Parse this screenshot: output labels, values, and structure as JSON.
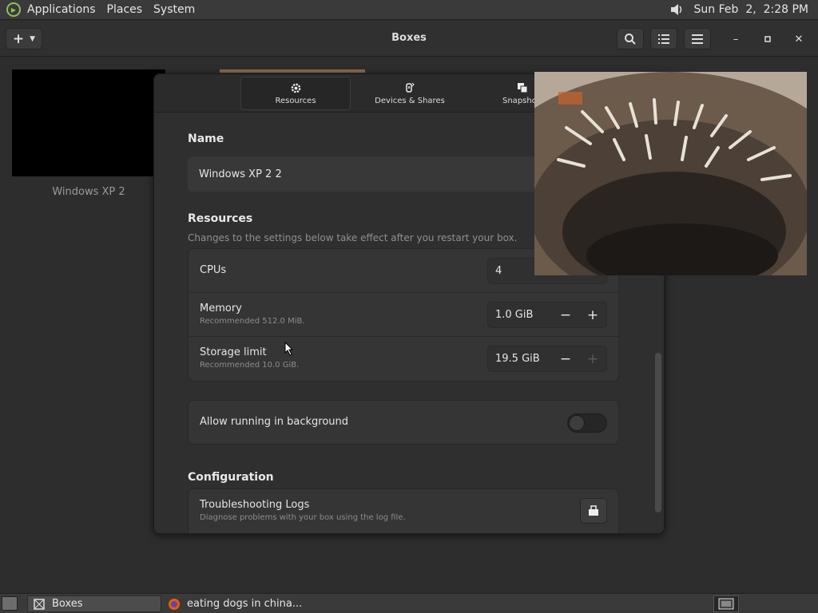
{
  "top_panel": {
    "menu": [
      "Applications",
      "Places",
      "System"
    ],
    "clock": "Sun Feb  2,  2:28 PM"
  },
  "headerbar": {
    "title": "Boxes"
  },
  "collection": {
    "vm_label": "Windows XP 2"
  },
  "dialog": {
    "tabs": [
      {
        "label": "Resources",
        "icon": "gear-icon",
        "active": true
      },
      {
        "label": "Devices & Shares",
        "icon": "usb-icon",
        "active": false
      },
      {
        "label": "Snapsho",
        "icon": "snapshot-icon",
        "active": false
      }
    ],
    "name_section": {
      "title": "Name",
      "value": "Windows XP 2 2"
    },
    "resources_section": {
      "title": "Resources",
      "subtitle": "Changes to the settings below take effect after you restart your box.",
      "rows": [
        {
          "title": "CPUs",
          "subtitle": "",
          "value": "4"
        },
        {
          "title": "Memory",
          "subtitle": "Recommended 512.0 MiB.",
          "value": "1.0 GiB"
        },
        {
          "title": "Storage limit",
          "subtitle": "Recommended 10.0 GiB.",
          "value": "19.5 GiB"
        }
      ]
    },
    "background_row": {
      "title": "Allow running in background",
      "enabled": false
    },
    "configuration_section": {
      "title": "Configuration",
      "logs_title": "Troubleshooting Logs",
      "logs_subtitle": "Diagnose problems with your box using the log file."
    }
  },
  "bottom_panel": {
    "tasks": [
      {
        "label": "Boxes",
        "icon": "boxes-icon",
        "active": true
      },
      {
        "label": "eating dogs in china...",
        "icon": "firefox-icon",
        "active": false
      }
    ]
  },
  "colors": {
    "accent": "#8fbf5a",
    "panel_bg": "#3a3a3a",
    "window_bg": "#2f2f2f"
  }
}
